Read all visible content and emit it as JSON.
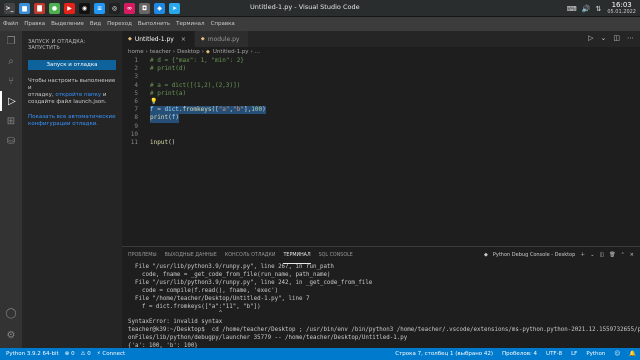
{
  "taskbar": {
    "title": "Untitled-1.py - Visual Studio Code",
    "time": "16:03",
    "date": "05.01.2022",
    "apps": [
      {
        "icon": "terminal-icon",
        "glyph": ">_",
        "color": "#444"
      },
      {
        "icon": "folder-icon",
        "glyph": "▆",
        "color": "#3b8fd6"
      },
      {
        "icon": "files-icon",
        "glyph": "▇",
        "color": "#c1392b"
      },
      {
        "icon": "chrome-icon",
        "glyph": "●",
        "color": "#4caf50"
      },
      {
        "icon": "youtube-icon",
        "glyph": "▶",
        "color": "#e62117"
      },
      {
        "icon": "github-icon",
        "glyph": "◉",
        "color": "#111"
      },
      {
        "icon": "snap-icon",
        "glyph": "≡",
        "color": "#2196f3"
      },
      {
        "icon": "app-icon",
        "glyph": "◎",
        "color": "#222"
      },
      {
        "icon": "media-icon",
        "glyph": "∞",
        "color": "#d81b60"
      },
      {
        "icon": "camera-icon",
        "glyph": "◘",
        "color": "#666"
      },
      {
        "icon": "vscode-icon",
        "glyph": "◆",
        "color": "#1e88e5"
      },
      {
        "icon": "telegram-icon",
        "glyph": "➤",
        "color": "#29a9eb"
      }
    ]
  },
  "menu": [
    "Файл",
    "Правка",
    "Выделение",
    "Вид",
    "Переход",
    "Выполнить",
    "Терминал",
    "Справка"
  ],
  "sidebar": {
    "title": "ЗАПУСК И ОТЛАДКА: ЗАПУСТИТЬ",
    "run_button": "Запуск и отладка",
    "text1_a": "Чтобы настроить выполнение и",
    "text1_b": "отладку,",
    "text1_link": "откройте папку",
    "text1_c": "и",
    "text1_d": "создайте файл launch.json.",
    "link2_a": "Показать все автоматические",
    "link2_b": "конфигурации отладки."
  },
  "editor": {
    "tabs": [
      {
        "label": "Untitled-1.py",
        "active": true
      },
      {
        "label": "module.py",
        "active": false
      }
    ],
    "breadcrumb": [
      "home",
      "teacher",
      "Desktop",
      "Untitled-1.py",
      "..."
    ],
    "lines": [
      {
        "n": "1",
        "tokens": [
          {
            "t": "# d = {\"max\": 1, \"min\": 2}",
            "c": "comment"
          }
        ]
      },
      {
        "n": "2",
        "tokens": [
          {
            "t": "# print(d)",
            "c": "comment"
          }
        ]
      },
      {
        "n": "3",
        "tokens": []
      },
      {
        "n": "4",
        "tokens": [
          {
            "t": "# a = dict([(1,2),(2,3)])",
            "c": "comment"
          }
        ]
      },
      {
        "n": "5",
        "tokens": [
          {
            "t": "# print(a)",
            "c": "comment"
          }
        ]
      },
      {
        "n": "6",
        "tokens": [],
        "bulb": true
      },
      {
        "n": "7",
        "tokens": [
          {
            "t": "f",
            "c": "var"
          },
          {
            "t": " = ",
            "c": "default"
          },
          {
            "t": "dict",
            "c": "var"
          },
          {
            "t": ".",
            "c": "default"
          },
          {
            "t": "fromkeys",
            "c": "fn"
          },
          {
            "t": "([",
            "c": "default"
          },
          {
            "t": "\"a\"",
            "c": "str"
          },
          {
            "t": ",",
            "c": "default"
          },
          {
            "t": "\"b\"",
            "c": "str"
          },
          {
            "t": "],",
            "c": "default"
          },
          {
            "t": "100",
            "c": "num"
          },
          {
            "t": ")",
            "c": "default"
          }
        ],
        "selected": true
      },
      {
        "n": "8",
        "tokens": [
          {
            "t": "print",
            "c": "fn"
          },
          {
            "t": "(",
            "c": "default"
          },
          {
            "t": "f",
            "c": "var"
          },
          {
            "t": ")",
            "c": "default"
          }
        ],
        "selected": true
      },
      {
        "n": "9",
        "tokens": []
      },
      {
        "n": "10",
        "tokens": []
      },
      {
        "n": "11",
        "tokens": [
          {
            "t": "input",
            "c": "fn"
          },
          {
            "t": "()",
            "c": "default"
          }
        ]
      }
    ]
  },
  "panel": {
    "tabs": [
      "ПРОБЛЕМЫ",
      "ВЫХОДНЫЕ ДАННЫЕ",
      "КОНСОЛЬ ОТЛАДКИ",
      "ТЕРМИНАЛ",
      "SQL CONSOLE"
    ],
    "active_tab": "ТЕРМИНАЛ",
    "terminal_name": "Python Debug Console - Desktop",
    "terminal_lines": [
      "  File \"/usr/lib/python3.9/runpy.py\", line 267, in run_path",
      "    code, fname = _get_code_from_file(run_name, path_name)",
      "  File \"/usr/lib/python3.9/runpy.py\", line 242, in _get_code_from_file",
      "    code = compile(f.read(), fname, 'exec')",
      "  File \"/home/teacher/Desktop/Untitled-1.py\", line 7",
      "    f = dict.fromkeys([\"a\":\"11\", \"b\"])",
      "                          ^",
      "SyntaxError: invalid syntax",
      "teacher@k39:~/Desktop$  cd /home/teacher/Desktop ; /usr/bin/env /bin/python3 /home/teacher/.vscode/extensions/ms-python.python-2021.12.1559732655/pyth",
      "onFiles/lib/python/debugpy/launcher 35779 -- /home/teacher/Desktop/Untitled-1.py",
      "{'a': 100, 'b': 100}",
      "teacher@k39:~/Desktop$ █"
    ]
  },
  "statusbar": {
    "python": "Python 3.9.2 64-bit",
    "errors": "⊗ 0",
    "warnings": "⚠ 0",
    "connect": "Connect",
    "position": "Строка 7, столбец 1 (выбрано 42)",
    "spaces": "Пробелов: 4",
    "encoding": "UTF-8",
    "eol": "LF",
    "language": "Python"
  },
  "colors": {
    "accent": "#007acc",
    "selection": "#264f78",
    "button": "#0e639c"
  }
}
